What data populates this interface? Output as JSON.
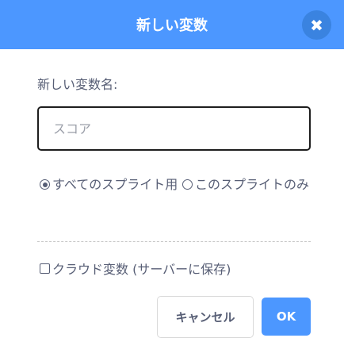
{
  "dialog": {
    "title": "新しい変数",
    "close_glyph": "✖",
    "close_icon": "close-icon",
    "prompt": "新しい変数名:",
    "input": {
      "value": "",
      "placeholder": "スコア"
    },
    "scope_options": [
      {
        "label": "すべてのスプライト用",
        "selected": true
      },
      {
        "label": "このスプライトのみ",
        "selected": false
      }
    ],
    "cloud_checkbox": {
      "label": "クラウド変数 (サーバーに保存)",
      "checked": false
    },
    "buttons": {
      "cancel": "キャンセル",
      "ok": "OK"
    },
    "colors": {
      "header": "#4c97ff",
      "accent": "#4c97ff",
      "text": "#575e75"
    }
  }
}
